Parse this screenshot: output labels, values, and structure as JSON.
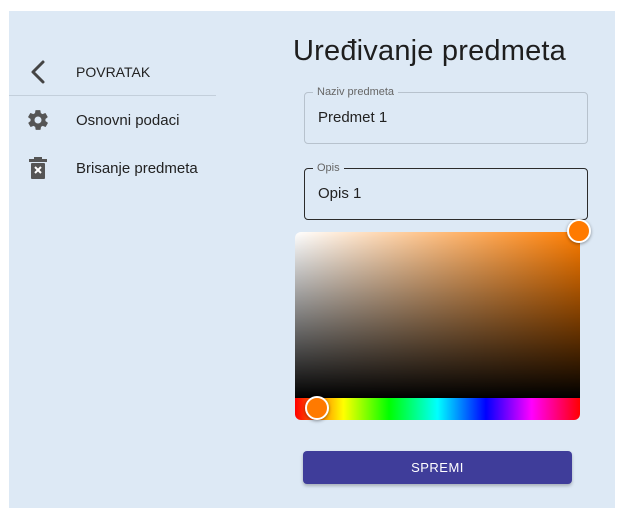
{
  "sidebar": {
    "back_label": "POVRATAK",
    "items": [
      {
        "label": "Osnovni podaci",
        "icon": "gear-icon"
      },
      {
        "label": "Brisanje predmeta",
        "icon": "trash-icon"
      }
    ]
  },
  "main": {
    "title": "Uređivanje predmeta",
    "name_field": {
      "legend": "Naziv predmeta",
      "value": "Predmet 1"
    },
    "desc_field": {
      "legend": "Opis",
      "value": "Opis 1"
    },
    "color_picker": {
      "hue_color": "#ff7d00",
      "selected_color": "#ff7a00"
    },
    "save_label": "SPREMI"
  },
  "colors": {
    "background": "#dde9f5",
    "primary": "#3f3d9a"
  }
}
